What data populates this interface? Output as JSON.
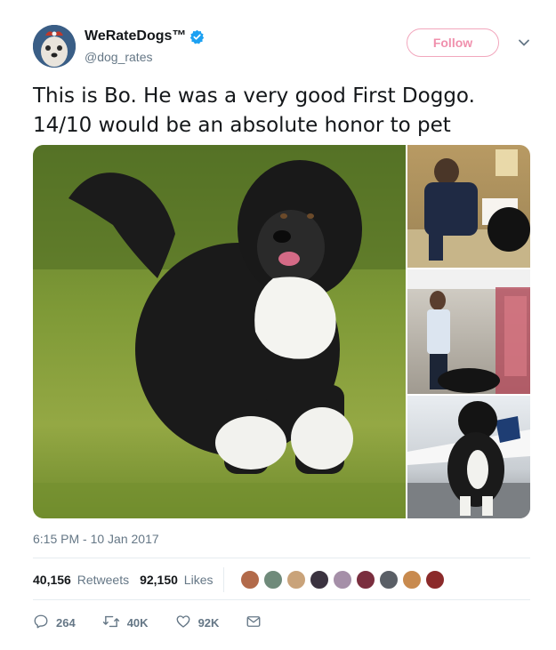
{
  "account": {
    "display_name": "WeRateDogs™",
    "handle": "@dog_rates",
    "verified_icon": "verified-badge-icon",
    "follow_label": "Follow",
    "accent_color": "#e0245e",
    "verified_color": "#1da1f2"
  },
  "tweet": {
    "text_line1": "This is Bo. He was a very good First Doggo.",
    "text_line2": "14/10 would be an absolute honor to pet",
    "timestamp": "6:15 PM - 10 Jan 2017"
  },
  "media": {
    "count": 4
  },
  "stats": {
    "retweets_count": "40,156",
    "retweets_label": "Retweets",
    "likes_count": "92,150",
    "likes_label": "Likes",
    "liker_avatar_count": 9
  },
  "actions": {
    "reply_count": "264",
    "retweet_count": "40K",
    "like_count": "92K"
  }
}
